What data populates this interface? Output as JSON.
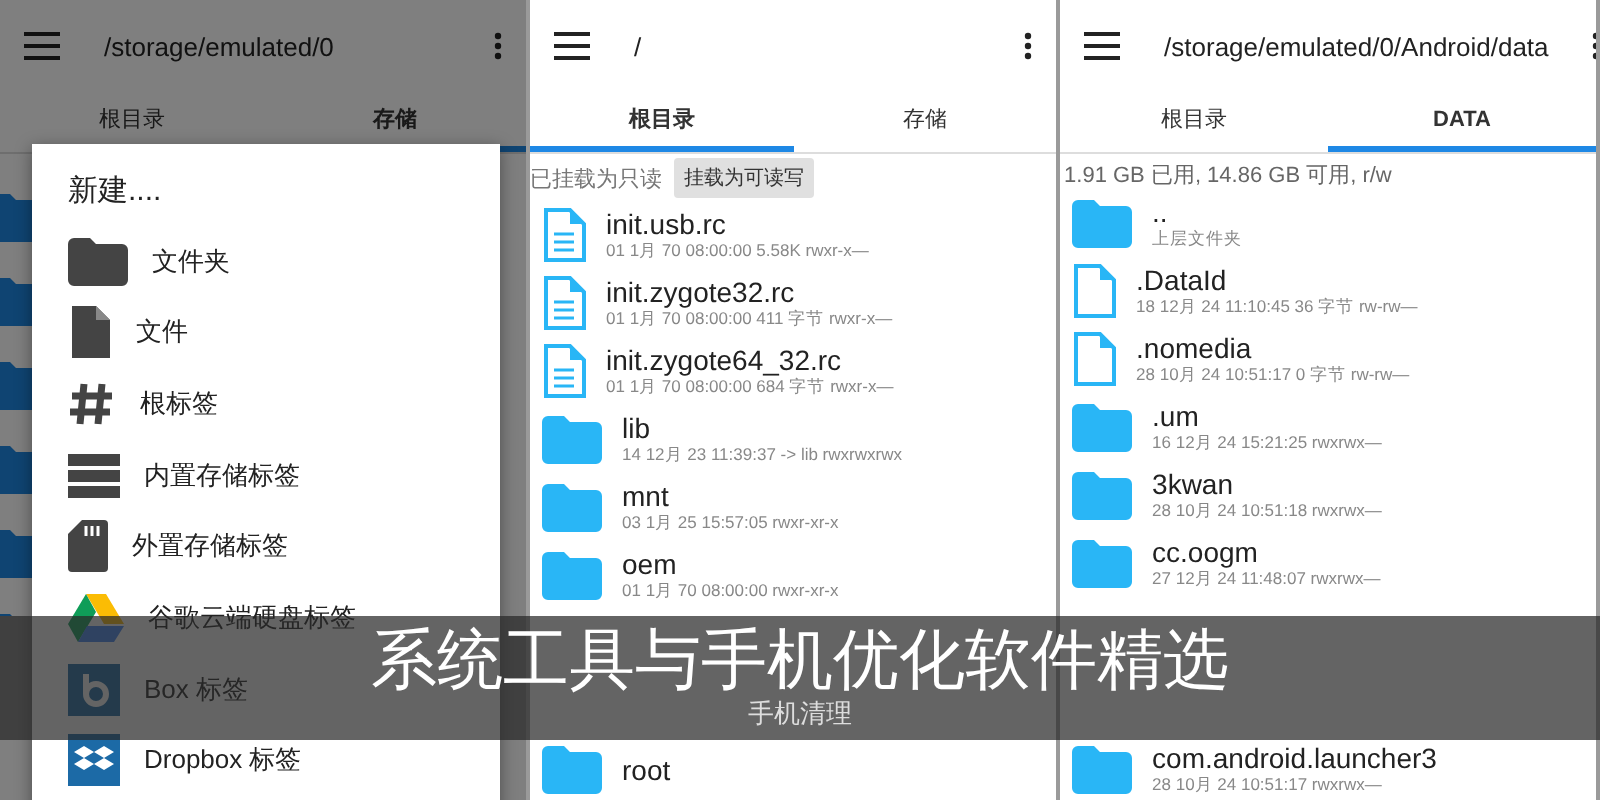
{
  "panels": [
    {
      "path": "/storage/emulated/0",
      "tabs": [
        {
          "label": "根目录",
          "selected": false
        },
        {
          "label": "存储",
          "selected": true
        }
      ],
      "dimmed": true,
      "dialog": {
        "title": "新建....",
        "items": [
          {
            "kind": "folder",
            "label": "文件夹"
          },
          {
            "kind": "file",
            "label": "文件"
          },
          {
            "kind": "hash",
            "label": "根标签"
          },
          {
            "kind": "storage",
            "label": "内置存储标签"
          },
          {
            "kind": "sdcard",
            "label": "外置存储标签"
          },
          {
            "kind": "drive",
            "label": "谷歌云端硬盘标签"
          },
          {
            "kind": "box",
            "label": "Box 标签"
          },
          {
            "kind": "dropbox",
            "label": "Dropbox 标签"
          }
        ]
      }
    },
    {
      "path": "/",
      "tabs": [
        {
          "label": "根目录",
          "selected": true
        },
        {
          "label": "存储",
          "selected": false
        }
      ],
      "dimmed": false,
      "mount": {
        "status": "已挂载为只读",
        "button": "挂载为可读写"
      },
      "entries": [
        {
          "kind": "text-file",
          "name": "init.usb.rc",
          "meta": "01 1月 70 08:00:00  5.58K  rwxr-x—"
        },
        {
          "kind": "text-file",
          "name": "init.zygote32.rc",
          "meta": "01 1月 70 08:00:00  411 字节  rwxr-x—"
        },
        {
          "kind": "text-file",
          "name": "init.zygote64_32.rc",
          "meta": "01 1月 70 08:00:00  684 字节  rwxr-x—"
        },
        {
          "kind": "folder",
          "name": "lib",
          "meta": "14 12月 23 11:39:37  -> lib  rwxrwxrwx"
        },
        {
          "kind": "folder",
          "name": "mnt",
          "meta": "03 1月 25 15:57:05    rwxr-xr-x"
        },
        {
          "kind": "folder",
          "name": "oem",
          "meta": "01 1月 70 08:00:00    rwxr-xr-x"
        }
      ],
      "entries_below": [
        {
          "kind": "folder",
          "name": "root"
        }
      ]
    },
    {
      "path": "/storage/emulated/0/Android/data",
      "tabs": [
        {
          "label": "根目录",
          "selected": false
        },
        {
          "label": "DATA",
          "selected": true
        }
      ],
      "dimmed": false,
      "info": "1.91 GB 已用, 14.86 GB 可用, r/w",
      "entries": [
        {
          "kind": "folder",
          "name": "..",
          "meta": "上层文件夹"
        },
        {
          "kind": "file",
          "name": ".DataId",
          "meta": "18 12月 24 11:10:45  36 字节  rw-rw—"
        },
        {
          "kind": "file",
          "name": ".nomedia",
          "meta": "28 10月 24 10:51:17  0 字节  rw-rw—"
        },
        {
          "kind": "folder",
          "name": ".um",
          "meta": "16 12月 24 15:21:25    rwxrwx—"
        },
        {
          "kind": "folder",
          "name": "3kwan",
          "meta": "28 10月 24 10:51:18    rwxrwx—"
        },
        {
          "kind": "folder",
          "name": "cc.oogm",
          "meta": "27 12月 24 11:48:07    rwxrwx—"
        }
      ],
      "entries_below": [
        {
          "kind": "folder",
          "name": "com.android.launcher3",
          "meta": "28 10月 24 10:51:17    rwxrwx—"
        }
      ]
    }
  ],
  "banner": {
    "title": "系统工具与手机优化软件精选",
    "subtitle": "手机清理"
  }
}
